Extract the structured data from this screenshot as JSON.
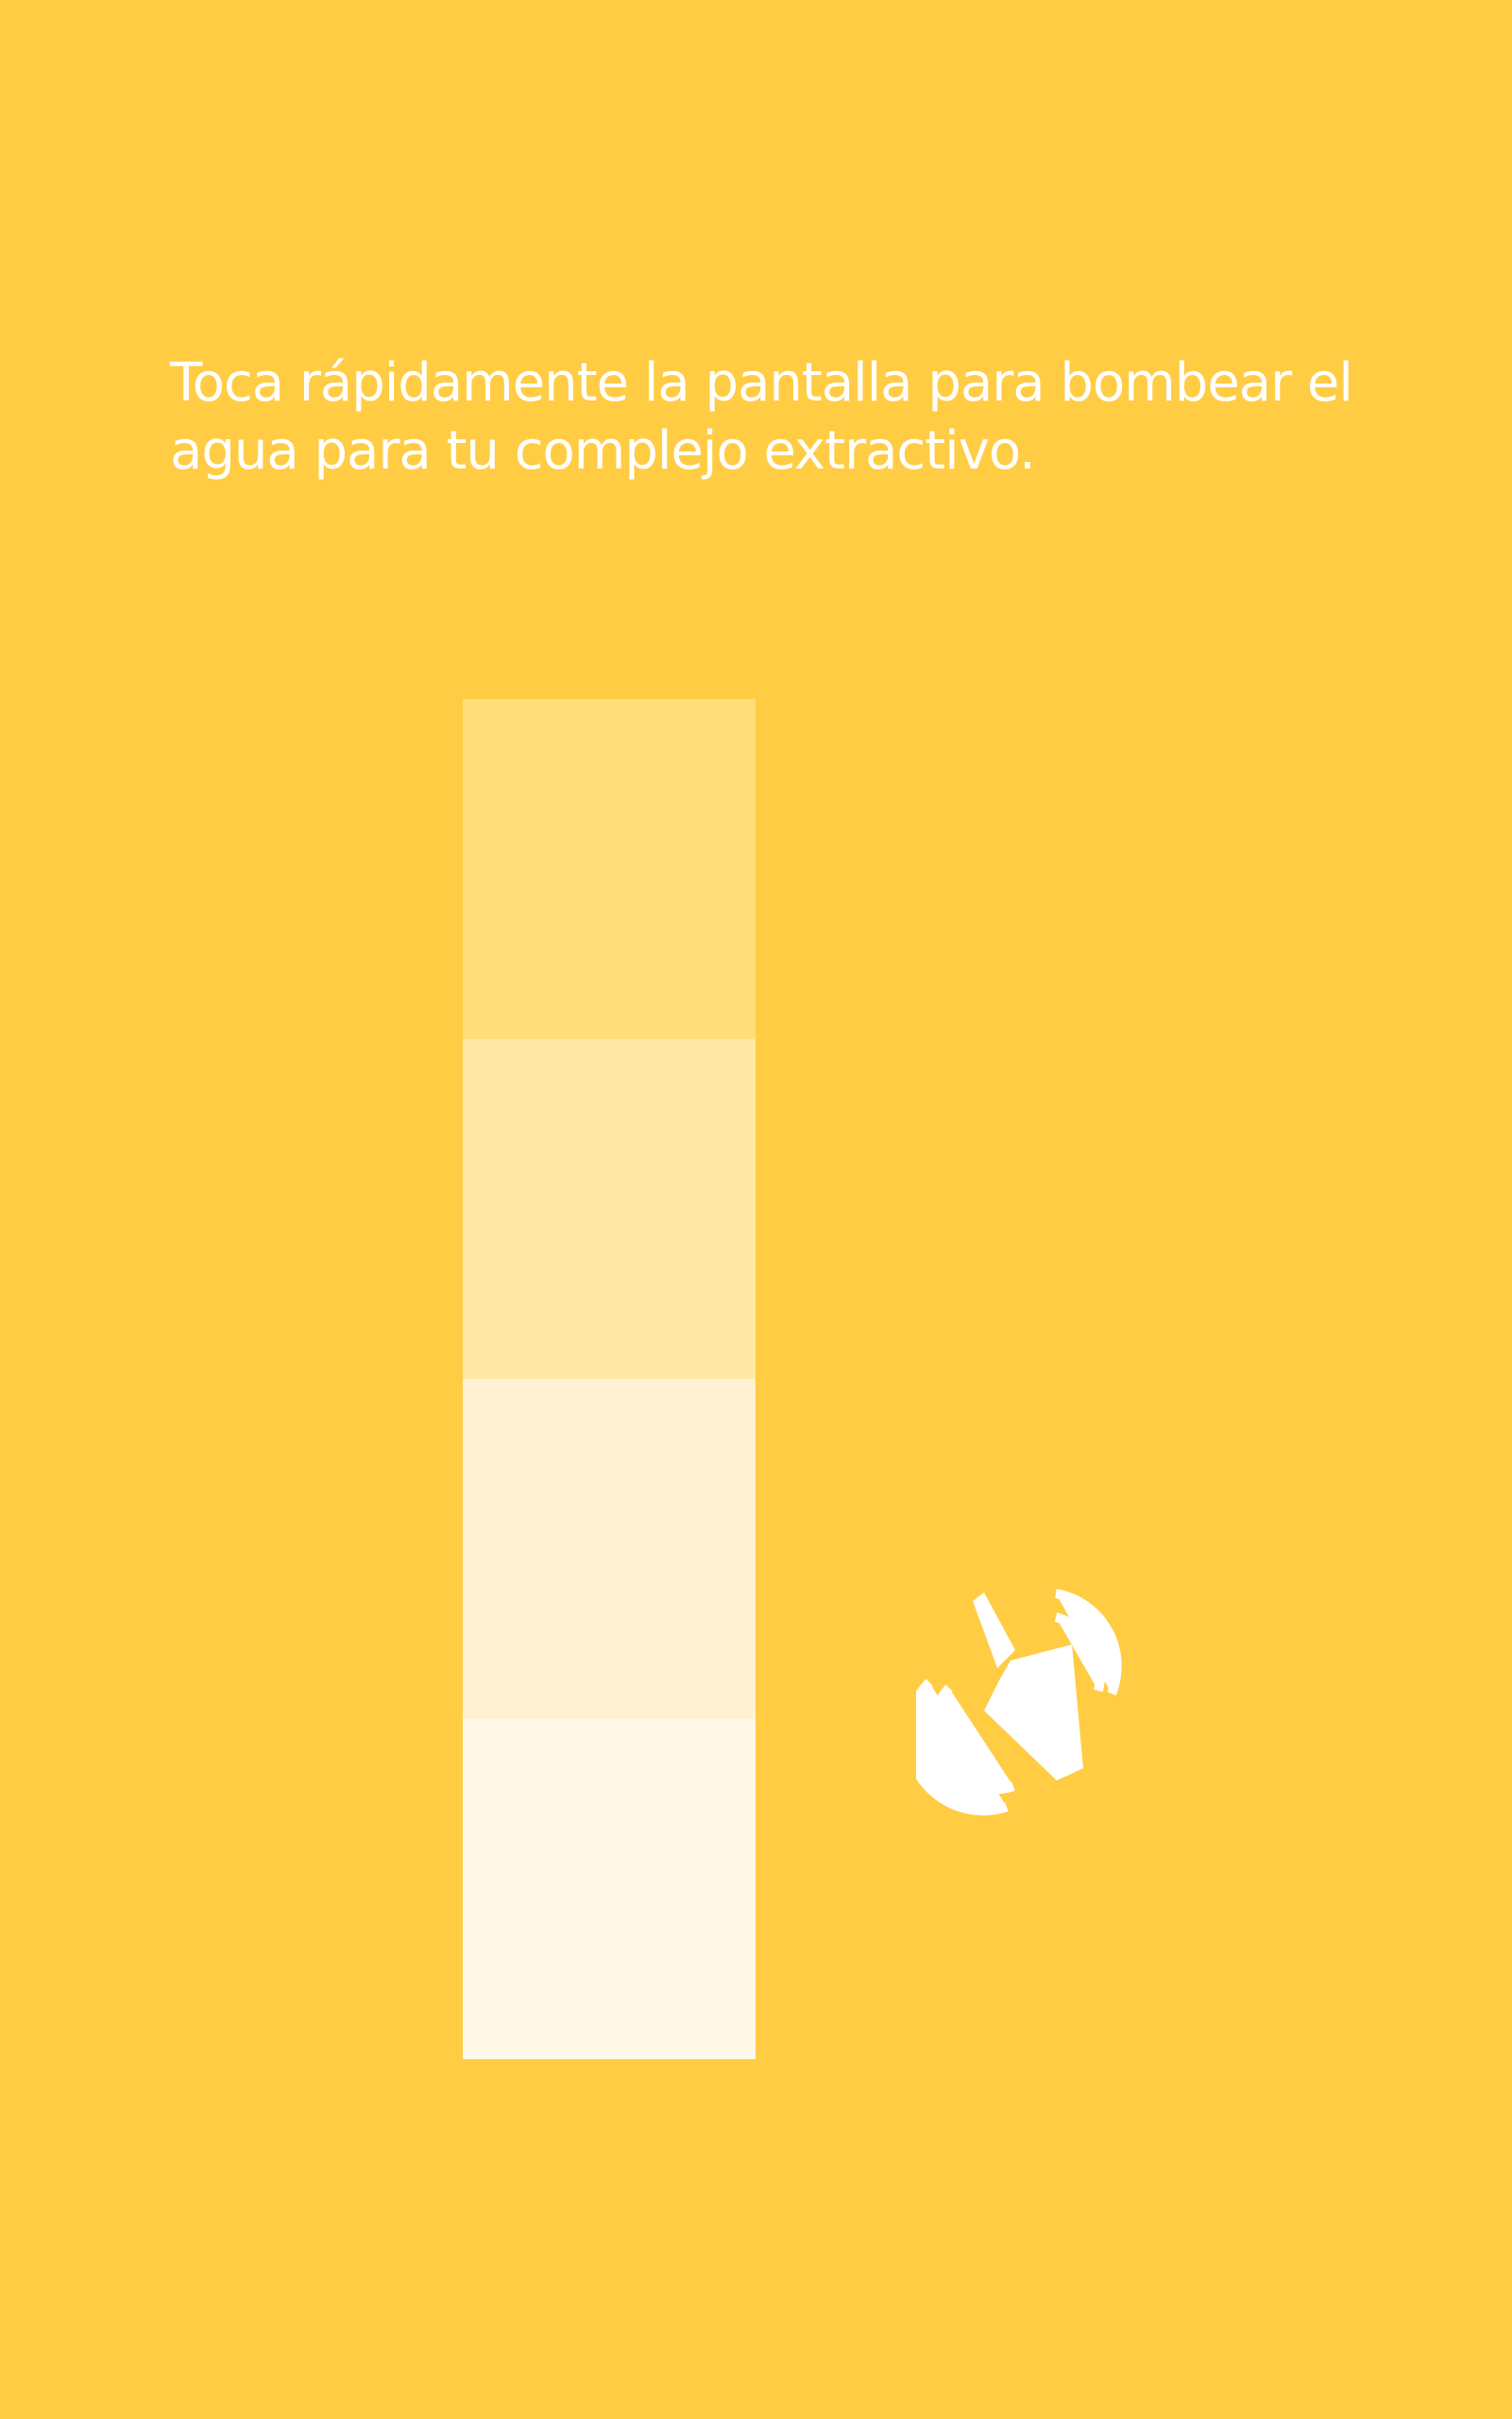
{
  "screen": {
    "background_color": "#FFCC44"
  },
  "instructions": {
    "text": "Toca rápidamente la pantalla para bombear el agua para tu complejo extractivo."
  },
  "pump_meter": {
    "level": 0,
    "segment_count": 4,
    "segment_colors": [
      "#FFDD7A",
      "#FFE8A6",
      "#FFF2D2",
      "#FFF8E9"
    ]
  },
  "tap_icon": {
    "icon": "tapping-finger-icon",
    "color": "#FFFFFF"
  }
}
